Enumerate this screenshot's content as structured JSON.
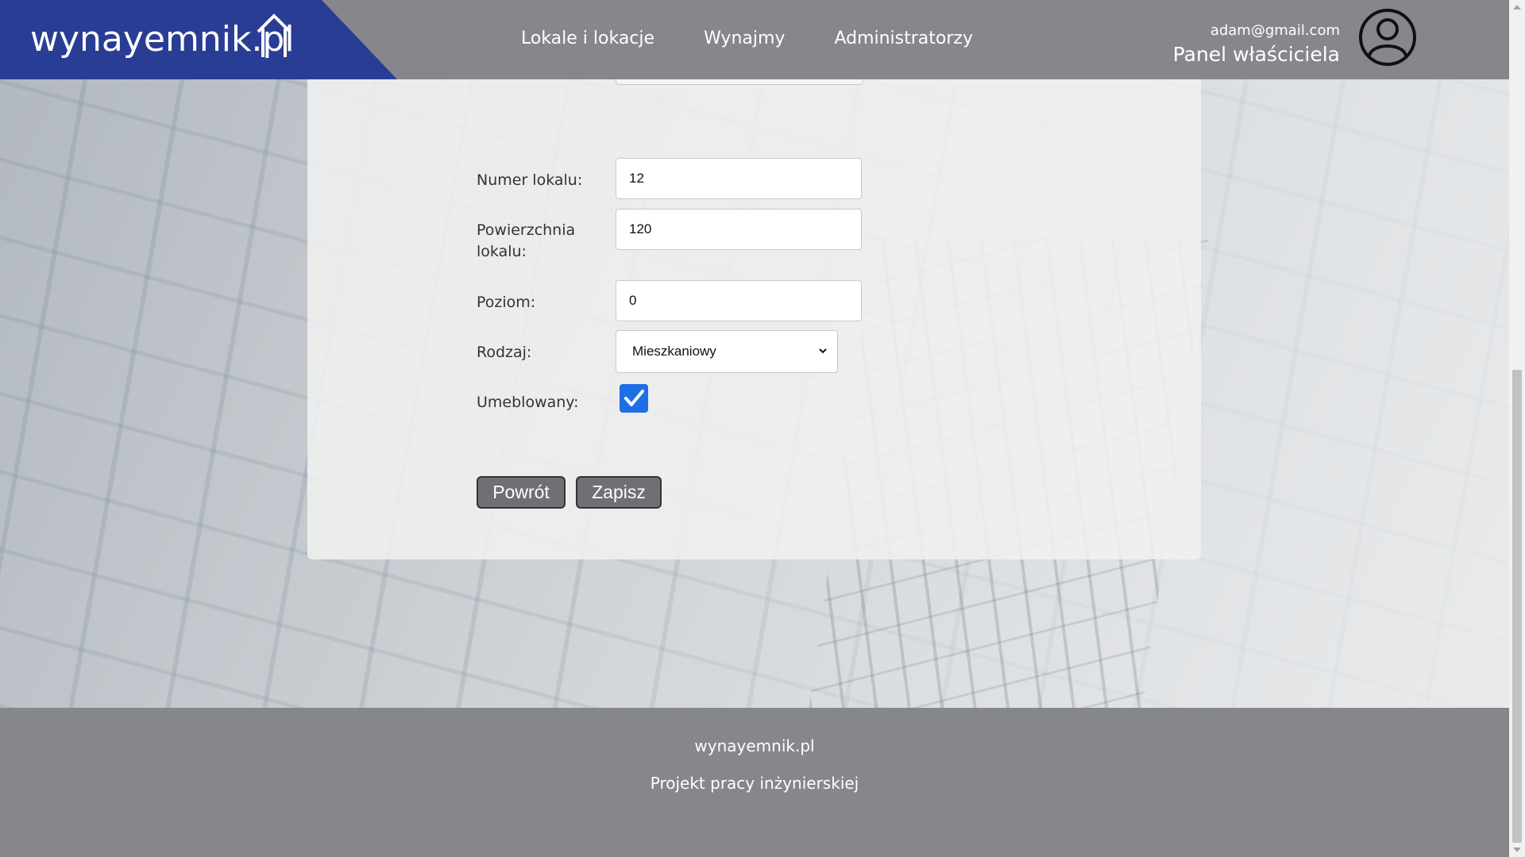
{
  "header": {
    "logo_text": "wynayemnik.pl",
    "nav": [
      "Lokale i lokacje",
      "Wynajmy",
      "Administratorzy"
    ],
    "user_email": "adam@gmail.com",
    "user_panel": "Panel właściciela"
  },
  "form": {
    "fields": {
      "numer_label": "Numer lokalu:",
      "numer_value": "12",
      "powierzchnia_label_line1": "Powierzchnia",
      "powierzchnia_label_line2": "lokalu:",
      "powierzchnia_value": "120",
      "poziom_label": "Poziom:",
      "poziom_value": "0",
      "rodzaj_label": "Rodzaj:",
      "rodzaj_value": "Mieszkaniowy",
      "umeblowany_label": "Umeblowany:",
      "umeblowany_checked": true
    },
    "buttons": {
      "back": "Powrót",
      "save": "Zapisz"
    }
  },
  "footer": {
    "site": "wynayemnik.pl",
    "subtitle": "Projekt pracy inżynierskiej"
  },
  "colors": {
    "header_bg": "#86878c",
    "logo_bg": "#2a3d94",
    "checkbox_accent": "#1e6fe6",
    "button_bg": "#6f7073"
  }
}
